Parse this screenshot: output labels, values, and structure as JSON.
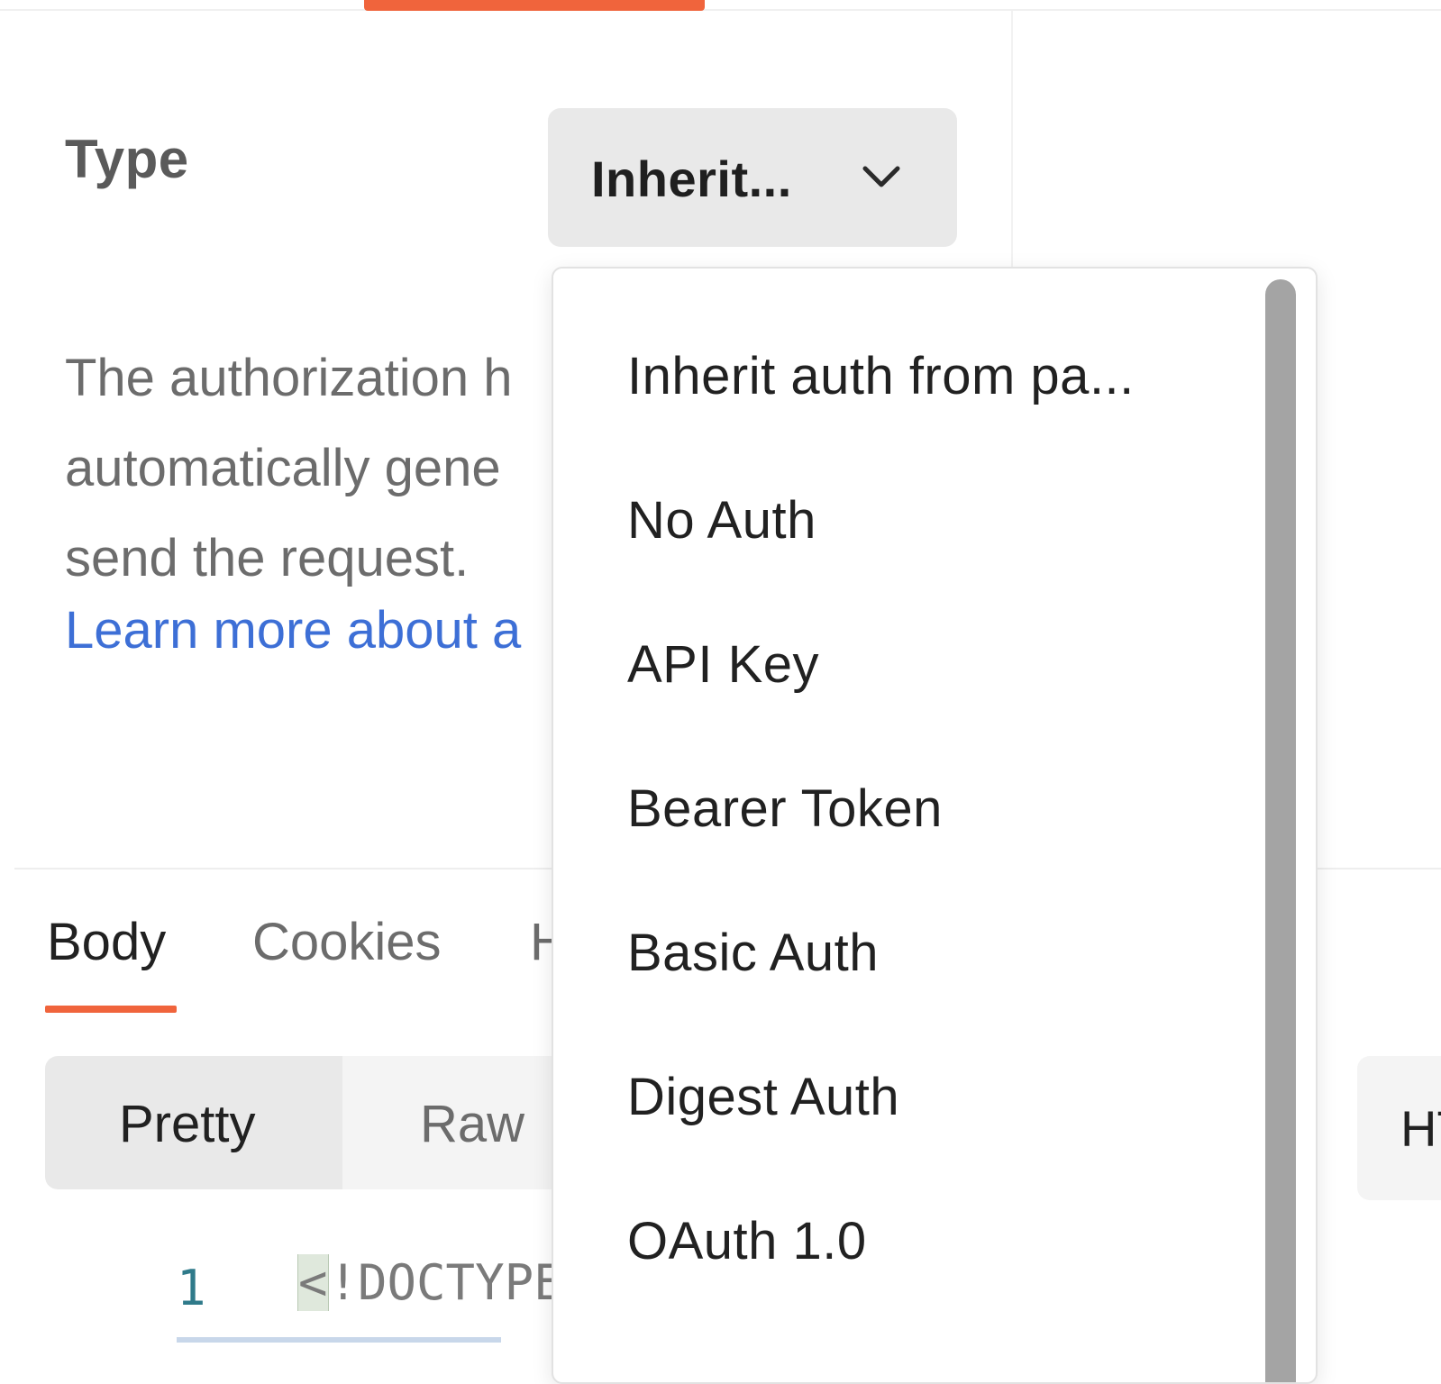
{
  "auth": {
    "type_label": "Type",
    "type_selected": "Inherit...",
    "description_lines": [
      "The authorization h",
      "automatically gene",
      "send the request."
    ],
    "learn_more_link": "Learn more about a"
  },
  "auth_type_dropdown": {
    "options": [
      "Inherit auth from pa...",
      "No Auth",
      "API Key",
      "Bearer Token",
      "Basic Auth",
      "Digest Auth",
      "OAuth 1.0"
    ]
  },
  "response": {
    "tabs": [
      "Body",
      "Cookies",
      "H"
    ],
    "active_tab": "Body",
    "view_modes": [
      "Pretty",
      "Raw"
    ],
    "active_view_mode": "Pretty",
    "format": "HT",
    "code": {
      "line_number": "1",
      "first_line_bracket": "<",
      "first_line_rest": "!DOCTYPE"
    }
  },
  "colors": {
    "accent": "#f0643c",
    "link": "#3d6fd6"
  },
  "icons": {
    "type_select": "chevron-down-icon"
  }
}
